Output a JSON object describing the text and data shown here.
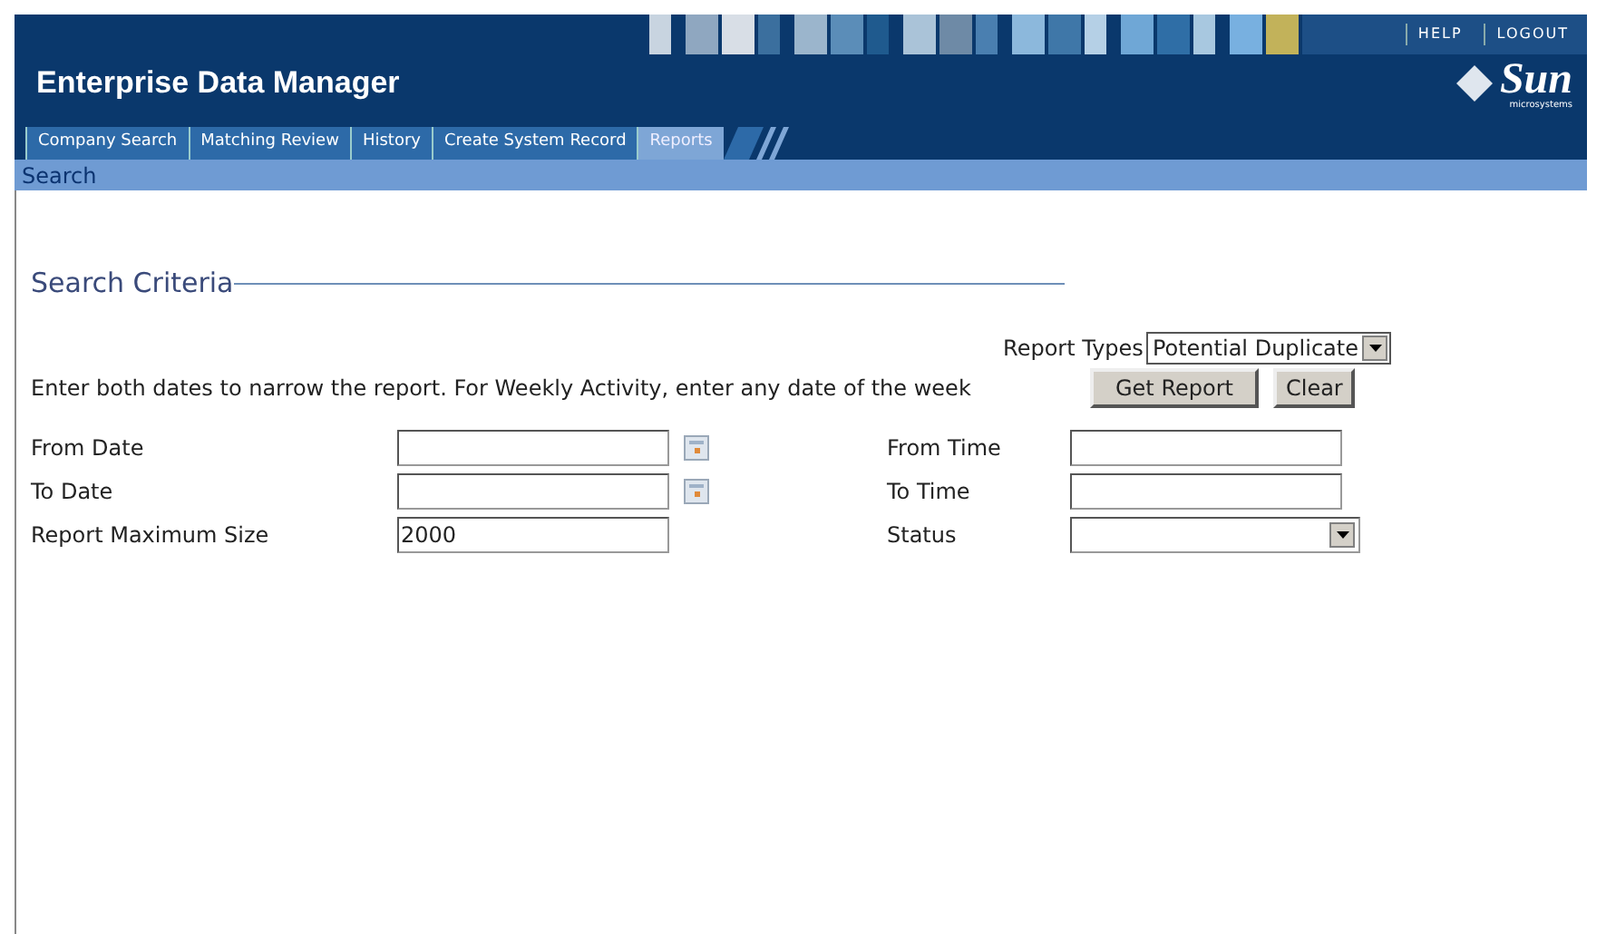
{
  "header": {
    "title": "Enterprise Data Manager",
    "links": [
      "HELP",
      "LOGOUT"
    ],
    "logo": {
      "name": "Sun",
      "subtitle": "microsystems"
    }
  },
  "tabs": [
    {
      "label": "Company Search",
      "selected": false
    },
    {
      "label": "Matching Review",
      "selected": false
    },
    {
      "label": "History",
      "selected": false
    },
    {
      "label": "Create System Record",
      "selected": false
    },
    {
      "label": "Reports",
      "selected": true
    }
  ],
  "subnav": {
    "label": "Search"
  },
  "section_title": "Search Criteria",
  "report_types": {
    "label": "Report Types",
    "value": "Potential Duplicate"
  },
  "hint": "Enter both dates to narrow the report. For Weekly Activity, enter any date of the week",
  "buttons": [
    "Get Report",
    "Clear"
  ],
  "left_fields": [
    {
      "label": "From Date",
      "kind": "date"
    },
    {
      "label": "To Date",
      "kind": "date"
    },
    {
      "label": "Report Maximum Size",
      "kind": "text",
      "value": "2000"
    }
  ],
  "right_fields": [
    {
      "label": "From Time",
      "kind": "text"
    },
    {
      "label": "To Time",
      "kind": "text"
    },
    {
      "label": "Status",
      "kind": "select"
    }
  ]
}
